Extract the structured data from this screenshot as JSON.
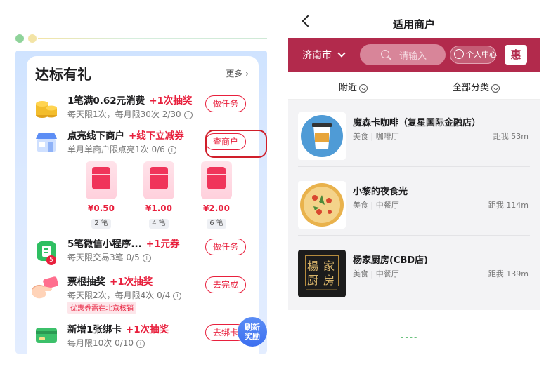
{
  "left": {
    "title": "达标有礼",
    "more": "更多 ›",
    "tasks": [
      {
        "name": "1笔满0.62元消费",
        "reward": "+1次抽奖",
        "sub": "每天限1次，每月限30次 2/30",
        "button": "做任务"
      },
      {
        "name": "点亮线下商户",
        "reward": "+线下立减券",
        "sub": "单月单商户限点亮1次 0/6",
        "button": "查商户"
      },
      {
        "name": "5笔微信小程序...",
        "reward": "+1元券",
        "sub": "每天限交易3笔 0/5",
        "button": "做任务",
        "badge": "5"
      },
      {
        "name": "票根抽奖",
        "reward": "+1次抽奖",
        "sub": "每天限2次，每月限4次 0/4",
        "button": "去完成",
        "note": "优惠券需在北京核销"
      },
      {
        "name": "新增1张绑卡",
        "reward": "+1次抽奖",
        "sub": "每月限10次 0/10",
        "button": "去绑卡"
      }
    ],
    "envelopes": [
      {
        "amount": "¥0.50",
        "count": "2 笔"
      },
      {
        "amount": "¥1.00",
        "count": "4 笔"
      },
      {
        "amount": "¥2.00",
        "count": "6 笔"
      }
    ],
    "refresh_line1": "刷新",
    "refresh_line2": "奖励",
    "info_glyph": "i"
  },
  "right": {
    "title": "适用商户",
    "city": "济南市",
    "search_placeholder": "请输入",
    "user_center": "个人中心",
    "hui": "惠",
    "filter_nearby": "附近",
    "filter_category": "全部分类",
    "shops": [
      {
        "name": "魔森卡咖啡（复星国际金融店）",
        "category": "美食 | 咖啡厅",
        "distance": "距我 53m"
      },
      {
        "name": "小黎的夜食光",
        "category": "美食 | 中餐厅",
        "distance": "距我 114m"
      },
      {
        "name": "杨家厨房(CBD店)",
        "category": "美食 | 中餐厅",
        "distance": "距我 139m"
      }
    ],
    "logo3_chars": [
      "楊",
      "家",
      "厨",
      "房"
    ],
    "footer_dashes": "----"
  },
  "colors": {
    "accent_red": "#e8203d",
    "brand_bar": "#b22a4c",
    "highlight_ring": "#d01e2a"
  },
  "icons": {
    "task_icons": [
      "coins-icon",
      "storefront-icon",
      "wechat-miniprogram-icon",
      "hand-ticket-icon",
      "bank-card-icon"
    ]
  }
}
